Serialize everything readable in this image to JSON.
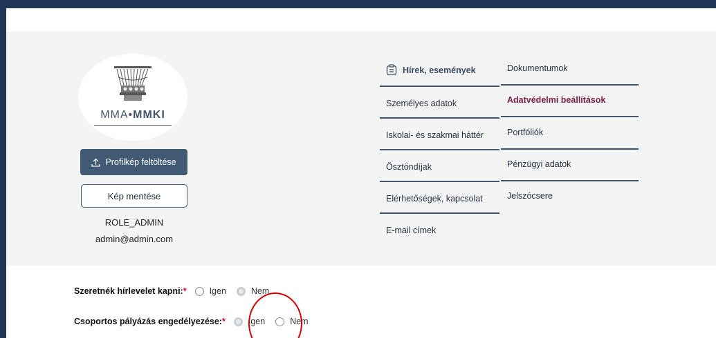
{
  "profile": {
    "logo_text_light": "MMA•",
    "logo_text_bold": "MMKI",
    "upload_button": "Profilkép feltöltése",
    "save_button": "Kép mentése",
    "role": "ROLE_ADMIN",
    "email": "admin@admin.com"
  },
  "menu": {
    "left": [
      {
        "label": "Hírek, események",
        "icon": "clipboard-icon"
      },
      {
        "label": "Személyes adatok"
      },
      {
        "label": "Iskolai- és szakmai háttér"
      },
      {
        "label": "Ösztöndíjak"
      },
      {
        "label": "Elérhetőségek, kapcsolat"
      },
      {
        "label": "E-mail címek"
      }
    ],
    "right": [
      {
        "label": "Dokumentumok"
      },
      {
        "label": "Adatvédelmi beállítások"
      },
      {
        "label": "Portfóliók"
      },
      {
        "label": "Pénzügyi adatok"
      },
      {
        "label": "Jelszócsere"
      }
    ]
  },
  "form": {
    "newsletter": {
      "label": "Szeretnék hírlevelet kapni:",
      "required": "*",
      "options": [
        "Igen",
        "Nem"
      ],
      "selected": "Nem"
    },
    "group_application": {
      "label": "Csoportos pályázás engedélyezése:",
      "required": "*",
      "options": [
        "Igen",
        "Nem"
      ],
      "selected": "Igen"
    }
  },
  "colors": {
    "frame": "#1f3558",
    "accent_button": "#3f5a72",
    "active_menu": "#7a1e44",
    "annotation_circle": "#d40000"
  }
}
